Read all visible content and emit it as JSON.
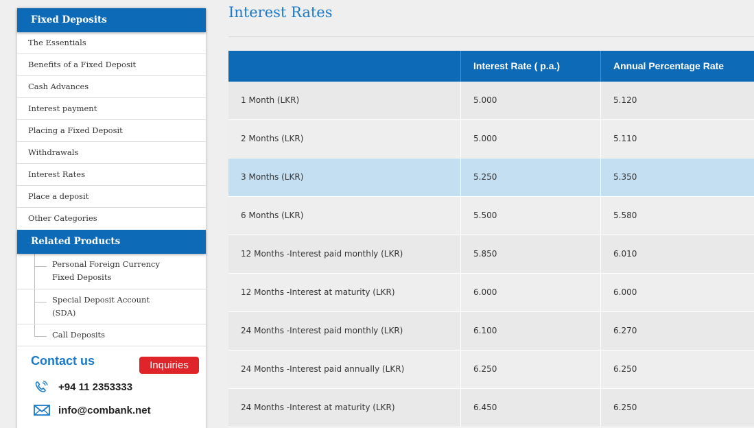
{
  "sidebar": {
    "heading": "Fixed Deposits",
    "items": [
      {
        "label": "The Essentials"
      },
      {
        "label": "Benefits of a Fixed Deposit"
      },
      {
        "label": "Cash Advances"
      },
      {
        "label": "Interest payment"
      },
      {
        "label": "Placing a Fixed Deposit"
      },
      {
        "label": "Withdrawals"
      },
      {
        "label": "Interest Rates"
      },
      {
        "label": "Place a deposit"
      },
      {
        "label": "Other Categories"
      }
    ],
    "related_heading": "Related Products",
    "related": [
      {
        "line1": "Personal Foreign Currency",
        "line2": "Fixed Deposits"
      },
      {
        "line1": "Special Deposit Account",
        "line2": "(SDA)"
      },
      {
        "line1": "Call Deposits"
      }
    ]
  },
  "contact": {
    "title": "Contact us",
    "inquiries_label": "Inquiries",
    "phone": "+94 11 2353333",
    "email": "info@combank.net",
    "phone_icon": "phone-icon",
    "email_icon": "envelope-icon"
  },
  "main": {
    "title": "Interest Rates",
    "table": {
      "headers": [
        "",
        "Interest Rate ( p.a.)",
        "Annual Percentage Rate"
      ],
      "rows": [
        {
          "term": "1 Month (LKR)",
          "rate": "5.000",
          "apr": "5.120"
        },
        {
          "term": "2 Months (LKR)",
          "rate": "5.000",
          "apr": "5.110"
        },
        {
          "term": "3 Months (LKR)",
          "rate": "5.250",
          "apr": "5.350"
        },
        {
          "term": "6 Months (LKR)",
          "rate": "5.500",
          "apr": "5.580"
        },
        {
          "term": "12 Months -Interest paid monthly (LKR)",
          "rate": "5.850",
          "apr": "6.010"
        },
        {
          "term": "12 Months -Interest at maturity (LKR)",
          "rate": "6.000",
          "apr": "6.000"
        },
        {
          "term": "24 Months -Interest paid monthly (LKR)",
          "rate": "6.100",
          "apr": "6.270"
        },
        {
          "term": "24 Months -Interest paid annually (LKR)",
          "rate": "6.250",
          "apr": "6.250"
        },
        {
          "term": "24 Months -Interest at maturity (LKR)",
          "rate": "6.450",
          "apr": "6.250"
        }
      ]
    }
  },
  "colors": {
    "brand_blue": "#0d6ab6",
    "title_blue": "#1a7ac8",
    "inquiries_red": "#e0252a",
    "highlight_row": "#c5dff2"
  }
}
